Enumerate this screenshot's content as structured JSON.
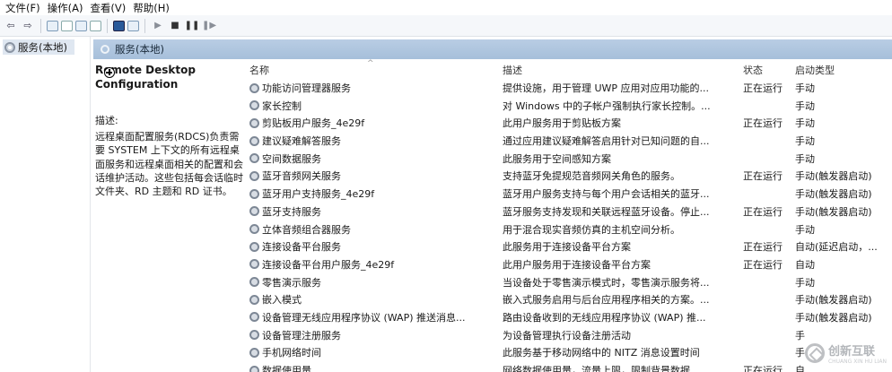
{
  "menu": [
    "文件(F)",
    "操作(A)",
    "查看(V)",
    "帮助(H)"
  ],
  "toolbar": {
    "icons": [
      "back-icon",
      "forward-icon",
      "console-tree-icon",
      "list-icon",
      "refresh-icon",
      "export-icon",
      "help-icon",
      "properties-icon",
      "start-icon",
      "stop-icon",
      "pause-icon",
      "restart-icon"
    ]
  },
  "tree": {
    "root_label": "服务(本地)"
  },
  "pane": {
    "header_label": "服务(本地)",
    "selected_title_line1": "Remote Desktop",
    "selected_title_line2": "Configuration",
    "desc_label": "描述:",
    "desc_text": "远程桌面配置服务(RDCS)负责需要 SYSTEM 上下文的所有远程桌面服务和远程桌面相关的配置和会话维护活动。这些包括每会话临时文件夹、RD 主题和 RD 证书。"
  },
  "table": {
    "headers": {
      "name": "名称",
      "desc": "描述",
      "status": "状态",
      "startup": "启动类型"
    },
    "rows": [
      {
        "name": "功能访问管理器服务",
        "desc": "提供设施，用于管理 UWP 应用对应用功能的...",
        "status": "正在运行",
        "startup": "手动"
      },
      {
        "name": "家长控制",
        "desc": "对 Windows 中的子帐户强制执行家长控制。...",
        "status": "",
        "startup": "手动"
      },
      {
        "name": "剪贴板用户服务_4e29f",
        "desc": "此用户服务用于剪贴板方案",
        "status": "正在运行",
        "startup": "手动"
      },
      {
        "name": "建议疑难解答服务",
        "desc": "通过应用建议疑难解答启用针对已知问题的自...",
        "status": "",
        "startup": "手动"
      },
      {
        "name": "空间数据服务",
        "desc": "此服务用于空间感知方案",
        "status": "",
        "startup": "手动"
      },
      {
        "name": "蓝牙音频网关服务",
        "desc": "支持蓝牙免提规范音频网关角色的服务。",
        "status": "正在运行",
        "startup": "手动(触发器启动)"
      },
      {
        "name": "蓝牙用户支持服务_4e29f",
        "desc": "蓝牙用户服务支持与每个用户会话相关的蓝牙...",
        "status": "",
        "startup": "手动(触发器启动)"
      },
      {
        "name": "蓝牙支持服务",
        "desc": "蓝牙服务支持发现和关联远程蓝牙设备。停止...",
        "status": "正在运行",
        "startup": "手动(触发器启动)"
      },
      {
        "name": "立体音频组合器服务",
        "desc": "用于混合现实音频仿真的主机空间分析。",
        "status": "",
        "startup": "手动"
      },
      {
        "name": "连接设备平台服务",
        "desc": "此服务用于连接设备平台方案",
        "status": "正在运行",
        "startup": "自动(延迟启动，..."
      },
      {
        "name": "连接设备平台用户服务_4e29f",
        "desc": "此用户服务用于连接设备平台方案",
        "status": "正在运行",
        "startup": "自动"
      },
      {
        "name": "零售演示服务",
        "desc": "当设备处于零售演示模式时，零售演示服务将...",
        "status": "",
        "startup": "手动"
      },
      {
        "name": "嵌入模式",
        "desc": "嵌入式服务启用与后台应用程序相关的方案。...",
        "status": "",
        "startup": "手动(触发器启动)"
      },
      {
        "name": "设备管理无线应用程序协议 (WAP) 推送消息...",
        "desc": "路由设备收到的无线应用程序协议 (WAP) 推...",
        "status": "",
        "startup": "手动(触发器启动)"
      },
      {
        "name": "设备管理注册服务",
        "desc": "为设备管理执行设备注册活动",
        "status": "",
        "startup": "手"
      },
      {
        "name": "手机网络时间",
        "desc": "此服务基于移动网络中的 NITZ 消息设置时间",
        "status": "",
        "startup": "手"
      },
      {
        "name": "数据使用量",
        "desc": "网络数据使用量，流量上限，限制背景数据...",
        "status": "正在运行",
        "startup": "自"
      }
    ]
  },
  "watermark": {
    "text": "创新互联",
    "sub": "CHUANG XIN HU LIAN"
  }
}
